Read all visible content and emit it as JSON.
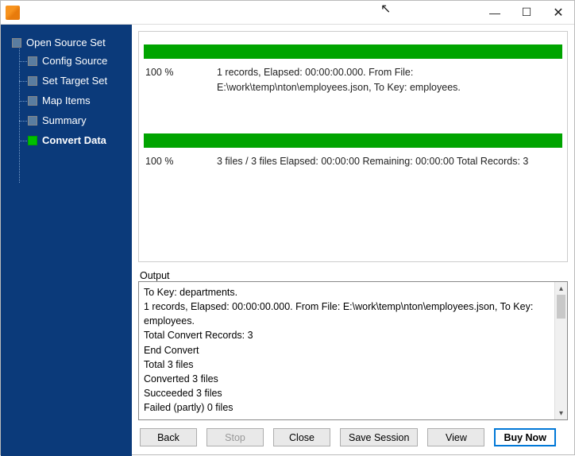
{
  "titlebar": {
    "title": ""
  },
  "sidebar": {
    "root": "Open Source Set",
    "items": [
      {
        "label": "Config Source",
        "active": false
      },
      {
        "label": "Set Target Set",
        "active": false
      },
      {
        "label": "Map Items",
        "active": false
      },
      {
        "label": "Summary",
        "active": false
      },
      {
        "label": "Convert Data",
        "active": true
      }
    ]
  },
  "progress1": {
    "pct": "100 %",
    "details": "1 records,    Elapsed: 00:00:00.000.    From File: E:\\work\\temp\\nton\\employees.json,    To Key: employees."
  },
  "progress2": {
    "pct": "100 %",
    "details": "3 files / 3 files    Elapsed: 00:00:00    Remaining: 00:00:00    Total Records: 3"
  },
  "output": {
    "label": "Output",
    "text": "To Key: departments.\n1 records,    Elapsed: 00:00:00.000.    From File: E:\\work\\temp\\nton\\employees.json,    To Key: employees.\nTotal Convert Records: 3\nEnd Convert\nTotal 3 files\nConverted 3 files\nSucceeded 3 files\nFailed (partly) 0 files"
  },
  "buttons": {
    "back": "Back",
    "stop": "Stop",
    "close": "Close",
    "save": "Save Session",
    "view": "View",
    "buy": "Buy Now"
  }
}
